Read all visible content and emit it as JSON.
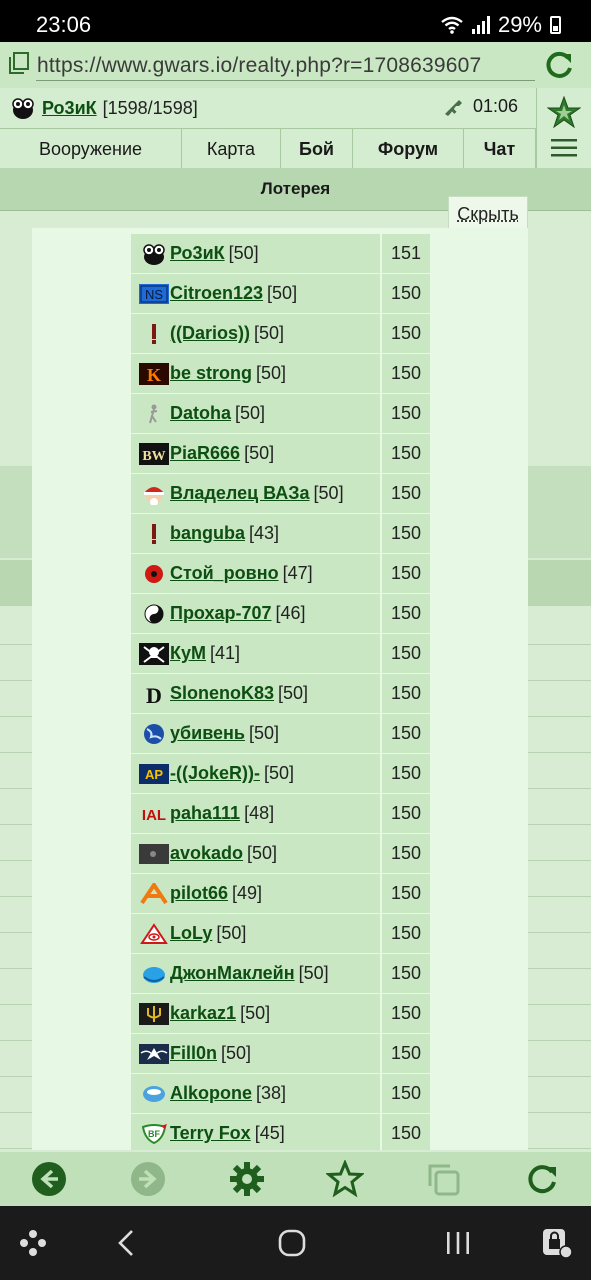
{
  "status": {
    "time": "23:06",
    "battery": "29%"
  },
  "browser": {
    "url": "https://www.gwars.io/realty.php?r=1708639607"
  },
  "header": {
    "user_name": "Ро3иК",
    "user_hp": "[1598/1598]",
    "clock": "01:06",
    "nav": [
      "Вооружение",
      "Карта",
      "Бой",
      "Форум",
      "Чат"
    ]
  },
  "background": {
    "lottery_title": "Лотерея",
    "hide_button": "Скрыть"
  },
  "players": [
    {
      "name": "Ро3иК",
      "level": "[50]",
      "score": "151",
      "avatar": "alien"
    },
    {
      "name": "Citroen123",
      "level": "[50]",
      "score": "150",
      "avatar": "ns"
    },
    {
      "name": "((Darios))",
      "level": "[50]",
      "score": "150",
      "avatar": "bar"
    },
    {
      "name": "be strong",
      "level": "[50]",
      "score": "150",
      "avatar": "k"
    },
    {
      "name": "Datoha",
      "level": "[50]",
      "score": "150",
      "avatar": "figure"
    },
    {
      "name": "PiaR666",
      "level": "[50]",
      "score": "150",
      "avatar": "bw"
    },
    {
      "name": "Владелец ВАЗа",
      "level": "[50]",
      "score": "150",
      "avatar": "santa"
    },
    {
      "name": "banguba",
      "level": "[43]",
      "score": "150",
      "avatar": "bar"
    },
    {
      "name": "Стой_ровно",
      "level": "[47]",
      "score": "150",
      "avatar": "poppy"
    },
    {
      "name": "Прохар-707",
      "level": "[46]",
      "score": "150",
      "avatar": "yinyang"
    },
    {
      "name": "КуМ",
      "level": "[41]",
      "score": "150",
      "avatar": "skull"
    },
    {
      "name": "SlonenoK83",
      "level": "[50]",
      "score": "150",
      "avatar": "d"
    },
    {
      "name": "убивень",
      "level": "[50]",
      "score": "150",
      "avatar": "globe"
    },
    {
      "name": "-((JokeR))-",
      "level": "[50]",
      "score": "150",
      "avatar": "ap"
    },
    {
      "name": "paha111",
      "level": "[48]",
      "score": "150",
      "avatar": "al"
    },
    {
      "name": "avokado",
      "level": "[50]",
      "score": "150",
      "avatar": "dark"
    },
    {
      "name": "pilot66",
      "level": "[49]",
      "score": "150",
      "avatar": "a"
    },
    {
      "name": "LoLy",
      "level": "[50]",
      "score": "150",
      "avatar": "eye"
    },
    {
      "name": "ДжонМаклейн",
      "level": "[50]",
      "score": "150",
      "avatar": "bluebird"
    },
    {
      "name": "karkaz1",
      "level": "[50]",
      "score": "150",
      "avatar": "trident"
    },
    {
      "name": "Fill0n",
      "level": "[50]",
      "score": "150",
      "avatar": "wings"
    },
    {
      "name": "Alkopone",
      "level": "[38]",
      "score": "150",
      "avatar": "glass"
    },
    {
      "name": "Terry Fox",
      "level": "[45]",
      "score": "150",
      "avatar": "bf"
    }
  ]
}
